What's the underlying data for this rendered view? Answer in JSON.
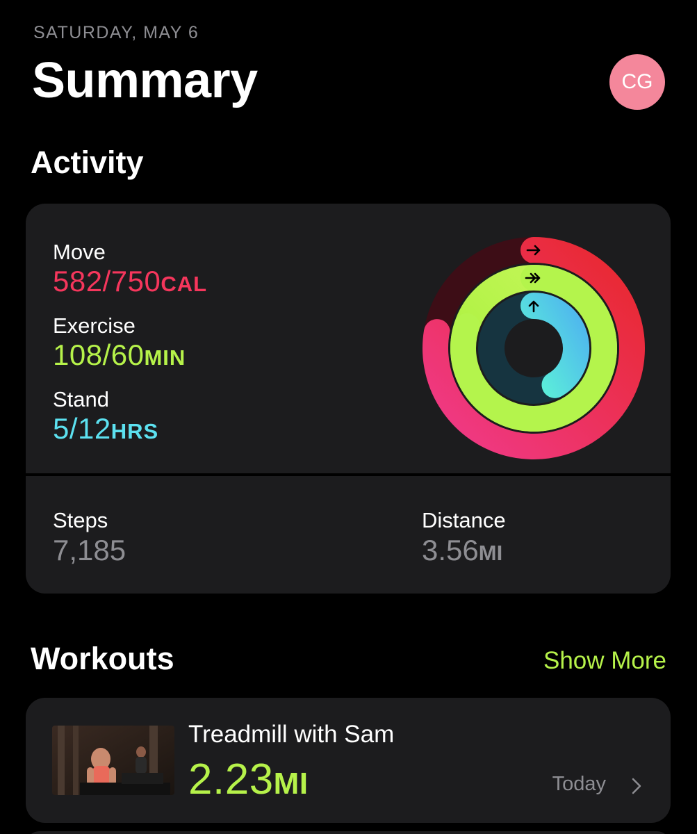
{
  "header": {
    "date": "SATURDAY, MAY 6",
    "title": "Summary",
    "avatar_initials": "CG"
  },
  "activity": {
    "section_title": "Activity",
    "move": {
      "label": "Move",
      "value": "582/750",
      "unit": "CAL",
      "color": "#f5365c",
      "progress": 0.776
    },
    "exercise": {
      "label": "Exercise",
      "value": "108/60",
      "unit": "MIN",
      "color": "#b6f24a",
      "progress": 1.8
    },
    "stand": {
      "label": "Stand",
      "value": "5/12",
      "unit": "HRS",
      "color": "#5ce1f0",
      "progress": 0.4167
    },
    "steps": {
      "label": "Steps",
      "value": "7,185"
    },
    "distance": {
      "label": "Distance",
      "value": "3.56",
      "unit": "MI"
    }
  },
  "workouts": {
    "section_title": "Workouts",
    "show_more": "Show More",
    "items": [
      {
        "name": "Treadmill with Sam",
        "value": "2.23",
        "unit": "MI",
        "date": "Today"
      }
    ]
  },
  "colors": {
    "background": "#000000",
    "card": "#1c1c1e",
    "secondary_text": "#8e8e93",
    "accent_green": "#b6f24a",
    "avatar": "#f4879b"
  }
}
